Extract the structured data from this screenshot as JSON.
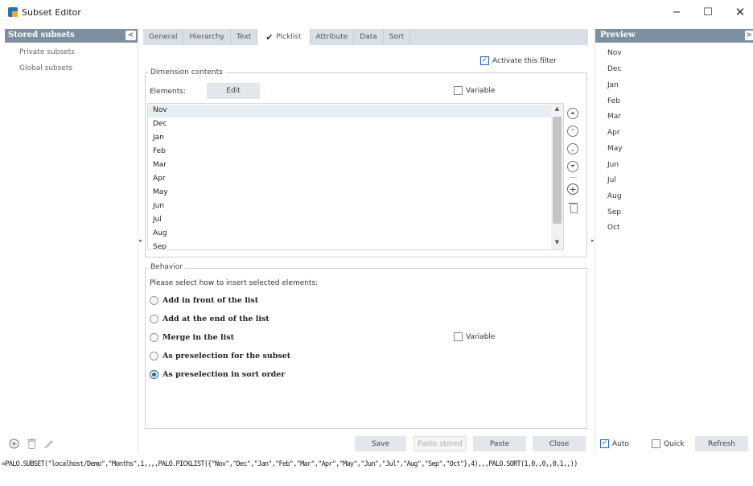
{
  "window": {
    "title": "Subset Editor",
    "controls": {
      "minimize": "−",
      "maximize": "☐",
      "close": "✕"
    }
  },
  "left_panel": {
    "header": "Stored subsets",
    "collapse": "<",
    "items": [
      "Private subsets",
      "Global subsets"
    ],
    "footer_icons": [
      "add-icon",
      "trash-icon",
      "pencil-icon"
    ]
  },
  "tabs": [
    {
      "label": "General"
    },
    {
      "label": "Hierarchy"
    },
    {
      "label": "Text"
    },
    {
      "label": "Picklist",
      "active": true,
      "check": "✔"
    },
    {
      "label": "Attribute"
    },
    {
      "label": "Data"
    },
    {
      "label": "Sort"
    }
  ],
  "picklist": {
    "activate_label": "Activate this filter",
    "activate_checked": true,
    "dimension_contents_legend": "Dimension contents",
    "elements_label": "Elements:",
    "edit_label": "Edit",
    "variable_label": "Variable",
    "list": [
      "Nov",
      "Dec",
      "Jan",
      "Feb",
      "Mar",
      "Apr",
      "May",
      "Jun",
      "Jul",
      "Aug",
      "Sep"
    ],
    "selected_index": 0,
    "behavior_legend": "Behavior",
    "behavior_prompt": "Please select how to insert selected elements:",
    "options": [
      {
        "label": "Add in front of the list",
        "selected": false
      },
      {
        "label": "Add at the end of the list",
        "selected": false
      },
      {
        "label": "Merge in the list",
        "selected": false
      },
      {
        "label": "As preselection for the subset",
        "selected": false
      },
      {
        "label": "As preselection in sort order",
        "selected": true
      }
    ],
    "behavior_variable_label": "Variable"
  },
  "buttons": {
    "save": "Save",
    "paste_stored": "Paste stored",
    "paste": "Paste",
    "close": "Close",
    "refresh": "Refresh"
  },
  "preview": {
    "header": "Preview",
    "collapse": ">",
    "items": [
      "Nov",
      "Dec",
      "Jan",
      "Feb",
      "Mar",
      "Apr",
      "May",
      "Jun",
      "Jul",
      "Aug",
      "Sep",
      "Oct"
    ],
    "auto_label": "Auto",
    "auto_checked": true,
    "quick_label": "Quick",
    "quick_checked": false
  },
  "formula": "=PALO.SUBSET(\"localhost/Demo\",\"Months\",1,,,,PALO.PICKLIST({\"Nov\",\"Dec\",\"Jan\",\"Feb\",\"Mar\",\"Apr\",\"May\",\"Jun\",\"Jul\",\"Aug\",\"Sep\",\"Oct\"},4),,,PALO.SORT(1,0,,0,,0,1,,))",
  "colors": {
    "panel_header": "#7e8fa0",
    "tabbar": "#d9dfe6",
    "accent": "#2563c0",
    "button": "#e3e6ea"
  }
}
